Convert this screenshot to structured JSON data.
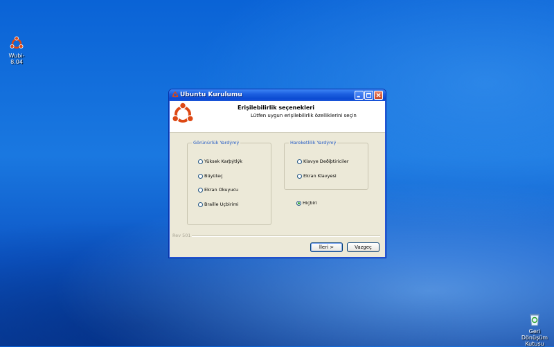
{
  "desktop": {
    "icons": [
      {
        "label": "Wubi-8.04",
        "icon": "ubuntu-logo-icon"
      },
      {
        "label_line1": "Geri Dönüşüm",
        "label_line2": "Kutusu",
        "icon": "recycle-bin-icon"
      }
    ]
  },
  "window": {
    "title": "Ubuntu Kurulumu",
    "header_title": "Erişilebilirlik seçenekleri",
    "header_subtitle": "Lütfen uygun erişilebilirlik özelliklerini seçin",
    "groups": [
      {
        "legend": "Görünürlük Yardýmý",
        "options": [
          "Yüksek Karþýtlýk",
          "Büyüteç",
          "Ekran Okuyucu",
          "Braille Uçbirimi"
        ]
      },
      {
        "legend": "Hareketlilik Yardýmý",
        "options": [
          "Klavye Deðiþtiriciler",
          "Ekran Klavyesi"
        ]
      }
    ],
    "none_option": "Hiçbiri",
    "selected": "Hiçbiri",
    "revision": "Rev 501",
    "next_label": "İleri >",
    "cancel_label": "Vazgeç"
  },
  "colors": {
    "accent": "#2259c4",
    "ubuntu_orange": "#dd4814",
    "titlebar": "#0a4ad2"
  }
}
